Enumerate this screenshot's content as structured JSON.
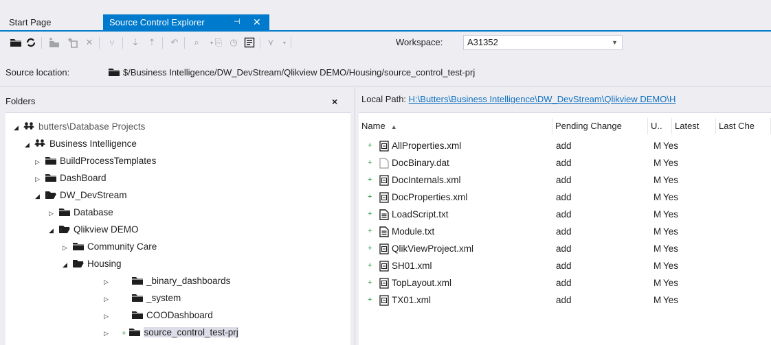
{
  "tabs": {
    "start_page": "Start Page",
    "source_control_explorer": "Source Control Explorer",
    "pin_glyph": "⊣",
    "close_glyph": "✕"
  },
  "toolbar": {
    "workspace_label": "Workspace:",
    "workspace_value": "A31352",
    "source_location_label": "Source location:",
    "source_location_value": "$/Business Intelligence/DW_DevStream/Qlikview DEMO/Housing/source_control_test-prj"
  },
  "folders": {
    "header": "Folders",
    "close_glyph": "×",
    "tree": [
      {
        "label": "butters\\Database Projects",
        "level": 0,
        "expander": "◢",
        "icon": "team-project-icon"
      },
      {
        "label": "Business Intelligence",
        "level": 1,
        "expander": "◢",
        "icon": "team-project-icon"
      },
      {
        "label": "BuildProcessTemplates",
        "level": 2,
        "expander": "▷",
        "icon": "folder-icon"
      },
      {
        "label": "DashBoard",
        "level": 2,
        "expander": "▷",
        "icon": "folder-icon"
      },
      {
        "label": "DW_DevStream",
        "level": 2,
        "expander": "◢",
        "icon": "folder-open-icon"
      },
      {
        "label": "Database",
        "level": 3,
        "expander": "▷",
        "icon": "folder-icon"
      },
      {
        "label": "Qlikview DEMO",
        "level": 3,
        "expander": "◢",
        "icon": "folder-open-icon"
      },
      {
        "label": "Community Care",
        "level": 4,
        "expander": "▷",
        "icon": "folder-icon"
      },
      {
        "label": "Housing",
        "level": 4,
        "expander": "◢",
        "icon": "folder-open-icon"
      },
      {
        "label": "_binary_dashboards",
        "level": 5,
        "expander": "▷",
        "icon": "folder-icon"
      },
      {
        "label": "_system",
        "level": 5,
        "expander": "▷",
        "icon": "folder-icon"
      },
      {
        "label": "COODashboard",
        "level": 5,
        "expander": "▷",
        "icon": "folder-icon"
      },
      {
        "label": "source_control_test-prj",
        "level": 5,
        "expander": "▷",
        "icon": "folder-icon",
        "pending_add": true,
        "selected": true
      }
    ]
  },
  "details": {
    "local_path_label": "Local Path:",
    "local_path_value": "H:\\Butters\\Business Intelligence\\DW_DevStream\\Qlikview DEMO\\H",
    "columns": [
      "Name",
      "Pending Change",
      "U..",
      "Latest",
      "Last Che"
    ],
    "sort_glyph": "▲",
    "rows": [
      {
        "name": "AllProperties.xml",
        "icon": "xml-file-icon",
        "pending": "add",
        "user": "M",
        "latest": "Yes"
      },
      {
        "name": "DocBinary.dat",
        "icon": "blank-file-icon",
        "pending": "add",
        "user": "M",
        "latest": "Yes"
      },
      {
        "name": "DocInternals.xml",
        "icon": "xml-file-icon",
        "pending": "add",
        "user": "M",
        "latest": "Yes"
      },
      {
        "name": "DocProperties.xml",
        "icon": "xml-file-icon",
        "pending": "add",
        "user": "M",
        "latest": "Yes"
      },
      {
        "name": "LoadScript.txt",
        "icon": "text-file-icon",
        "pending": "add",
        "user": "M",
        "latest": "Yes"
      },
      {
        "name": "Module.txt",
        "icon": "text-file-icon",
        "pending": "add",
        "user": "M",
        "latest": "Yes"
      },
      {
        "name": "QlikViewProject.xml",
        "icon": "xml-file-icon",
        "pending": "add",
        "user": "M",
        "latest": "Yes"
      },
      {
        "name": "SH01.xml",
        "icon": "xml-file-icon",
        "pending": "add",
        "user": "M",
        "latest": "Yes"
      },
      {
        "name": "TopLayout.xml",
        "icon": "xml-file-icon",
        "pending": "add",
        "user": "M",
        "latest": "Yes"
      },
      {
        "name": "TX01.xml",
        "icon": "xml-file-icon",
        "pending": "add",
        "user": "M",
        "latest": "Yes"
      }
    ]
  },
  "colors": {
    "accent": "#007acc",
    "pending_add": "#1e8e3e",
    "link": "#0e70c0",
    "selection": "#dddde9"
  }
}
